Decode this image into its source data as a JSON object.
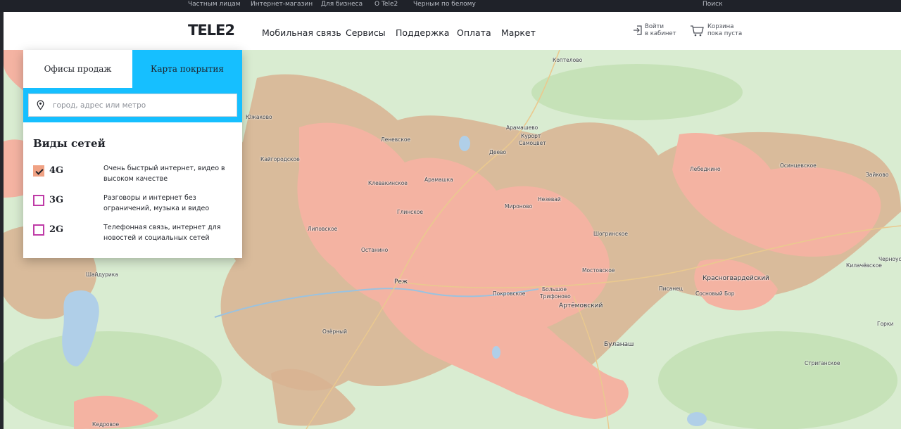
{
  "topbar": {
    "links": [
      "Частным лицам",
      "Интернет-магазин",
      "Для бизнеса",
      "О Tele2",
      "Черным по белому"
    ],
    "search": "Поиск"
  },
  "header": {
    "logo": "TELE2",
    "nav": [
      "Мобильная связь",
      "Сервисы",
      "Поддержка",
      "Оплата",
      "Маркет"
    ],
    "login": {
      "line1": "Войти",
      "line2": "в кабинет"
    },
    "cart": {
      "line1": "Корзина",
      "line2": "пока пуста"
    }
  },
  "panel": {
    "tabs": {
      "offices": "Офисы продаж",
      "coverage": "Карта покрытия"
    },
    "active_tab": "coverage",
    "search": {
      "placeholder": "город, адрес или метро",
      "value": ""
    },
    "networks_title": "Виды сетей",
    "networks": [
      {
        "label": "4G",
        "description": "Очень быстрый интернет, видео в высоком качестве",
        "checked": true
      },
      {
        "label": "3G",
        "description": "Разговоры и интернет без ограничений, музыка и видео",
        "checked": false
      },
      {
        "label": "2G",
        "description": "Телефонная связь, интернет для новостей и социальных сетей",
        "checked": false
      }
    ]
  },
  "map": {
    "places": [
      "Коптелово",
      "Южаково",
      "Арамашево",
      "Курорт",
      "Самоцвет",
      "Деево",
      "Леневское",
      "Кайгородское",
      "Лебедкино",
      "Осинцевское",
      "Зайково",
      "Клевакинское",
      "Арамашка",
      "Незевай",
      "Глинское",
      "Мироново",
      "Липовское",
      "Шогринское",
      "Останино",
      "Мостовское",
      "Реж",
      "Покровское",
      "Большое",
      "Трифоново",
      "Артёмовский",
      "Писанец",
      "Красногвардейский",
      "Сосновый Бор",
      "Килачёвское",
      "Черноусово",
      "Шайдурика",
      "Озёрный",
      "Буланаш",
      "Горки",
      "Стриганское",
      "Кедровое"
    ],
    "colors": {
      "background": "#d9ecd1",
      "coverage_4g": "#f4b3a2",
      "coverage_3g": "#d8b392",
      "forest": "#c2dfb4",
      "water": "#b0cfe8"
    }
  },
  "colors": {
    "accent": "#16bfff",
    "checkbox": "#bf3ba7",
    "dark": "#1f2229"
  },
  "icons": {
    "login": "login-icon",
    "cart": "cart-icon",
    "pin": "location-pin-icon"
  }
}
